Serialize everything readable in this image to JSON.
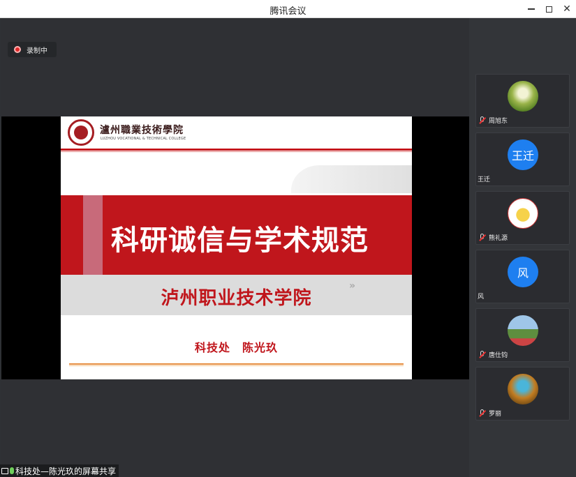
{
  "window": {
    "title": "腾讯会议"
  },
  "meeting": {
    "recording_label": "录制中",
    "share_label": "科技处—陈光玖的屏幕共享"
  },
  "slide": {
    "school_cn": "瀘州職業技術學院",
    "school_en": "LUZHOU VOCATIONAL & TECHNICAL COLLEGE",
    "main_title": "科研诚信与学术规范",
    "sub_title": "泸州职业技术学院",
    "chevron": "»",
    "presenter": "科技处　陈光玖"
  },
  "participants": [
    {
      "name": "周旭东",
      "avatar": "image",
      "muted": true
    },
    {
      "name": "王迁",
      "avatar": "text",
      "avatar_text": "王迁",
      "muted": false
    },
    {
      "name": "熊礼源",
      "avatar": "image",
      "muted": true
    },
    {
      "name": "风",
      "avatar": "text",
      "avatar_text": "风",
      "muted": false
    },
    {
      "name": "唐仕钧",
      "avatar": "image",
      "muted": true
    },
    {
      "name": "罗丽",
      "avatar": "image",
      "muted": true
    }
  ],
  "colors": {
    "accent_red": "#c0161c",
    "avatar_blue": "#1e7ff0",
    "panel_bg": "#333539"
  }
}
